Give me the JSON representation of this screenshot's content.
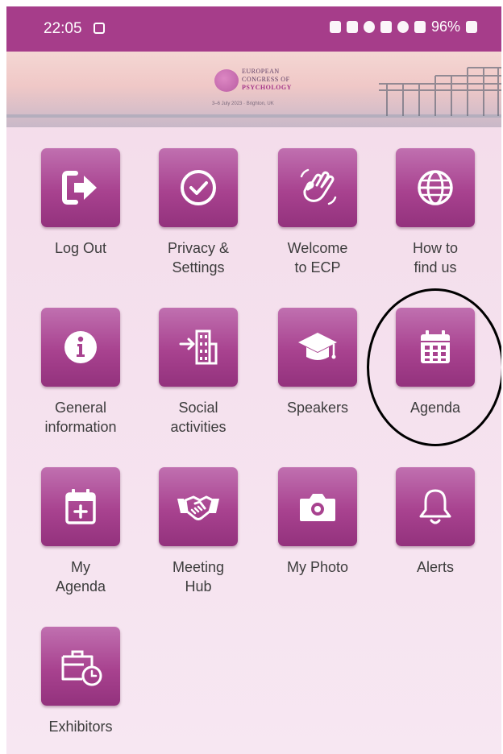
{
  "status_bar": {
    "time": "22:05",
    "battery": "96%",
    "icons": [
      "gallery-icon",
      "lock-icon",
      "nfc-icon",
      "alarm-icon",
      "mute-icon",
      "wifi-icon",
      "signal-icon",
      "battery-icon"
    ]
  },
  "banner": {
    "logo_line1": "EUROPEAN",
    "logo_line2": "CONGRESS OF",
    "logo_line3": "PSYCHOLOGY",
    "dates": "3–6 July 2023 · Brighton, UK"
  },
  "tiles": [
    {
      "label": "Log Out",
      "icon": "logout-icon"
    },
    {
      "label": "Privacy &\nSettings",
      "icon": "check-circle-icon"
    },
    {
      "label": "Welcome\nto ECP",
      "icon": "wave-hand-icon"
    },
    {
      "label": "How to\nfind us",
      "icon": "globe-icon"
    },
    {
      "label": "General\ninformation",
      "icon": "info-icon"
    },
    {
      "label": "Social\nactivities",
      "icon": "building-arrow-icon"
    },
    {
      "label": "Speakers",
      "icon": "graduation-cap-icon"
    },
    {
      "label": "Agenda",
      "icon": "calendar-icon"
    },
    {
      "label": "My\nAgenda",
      "icon": "calendar-plus-icon"
    },
    {
      "label": "Meeting\nHub",
      "icon": "handshake-icon"
    },
    {
      "label": "My Photo",
      "icon": "camera-icon"
    },
    {
      "label": "Alerts",
      "icon": "bell-icon"
    },
    {
      "label": "Exhibitors",
      "icon": "briefcase-clock-icon"
    }
  ],
  "colors": {
    "status_bar": "#a63d8a",
    "tile": "#a8428f",
    "background": "#f5e1ee",
    "highlight_ring": "#000000"
  }
}
